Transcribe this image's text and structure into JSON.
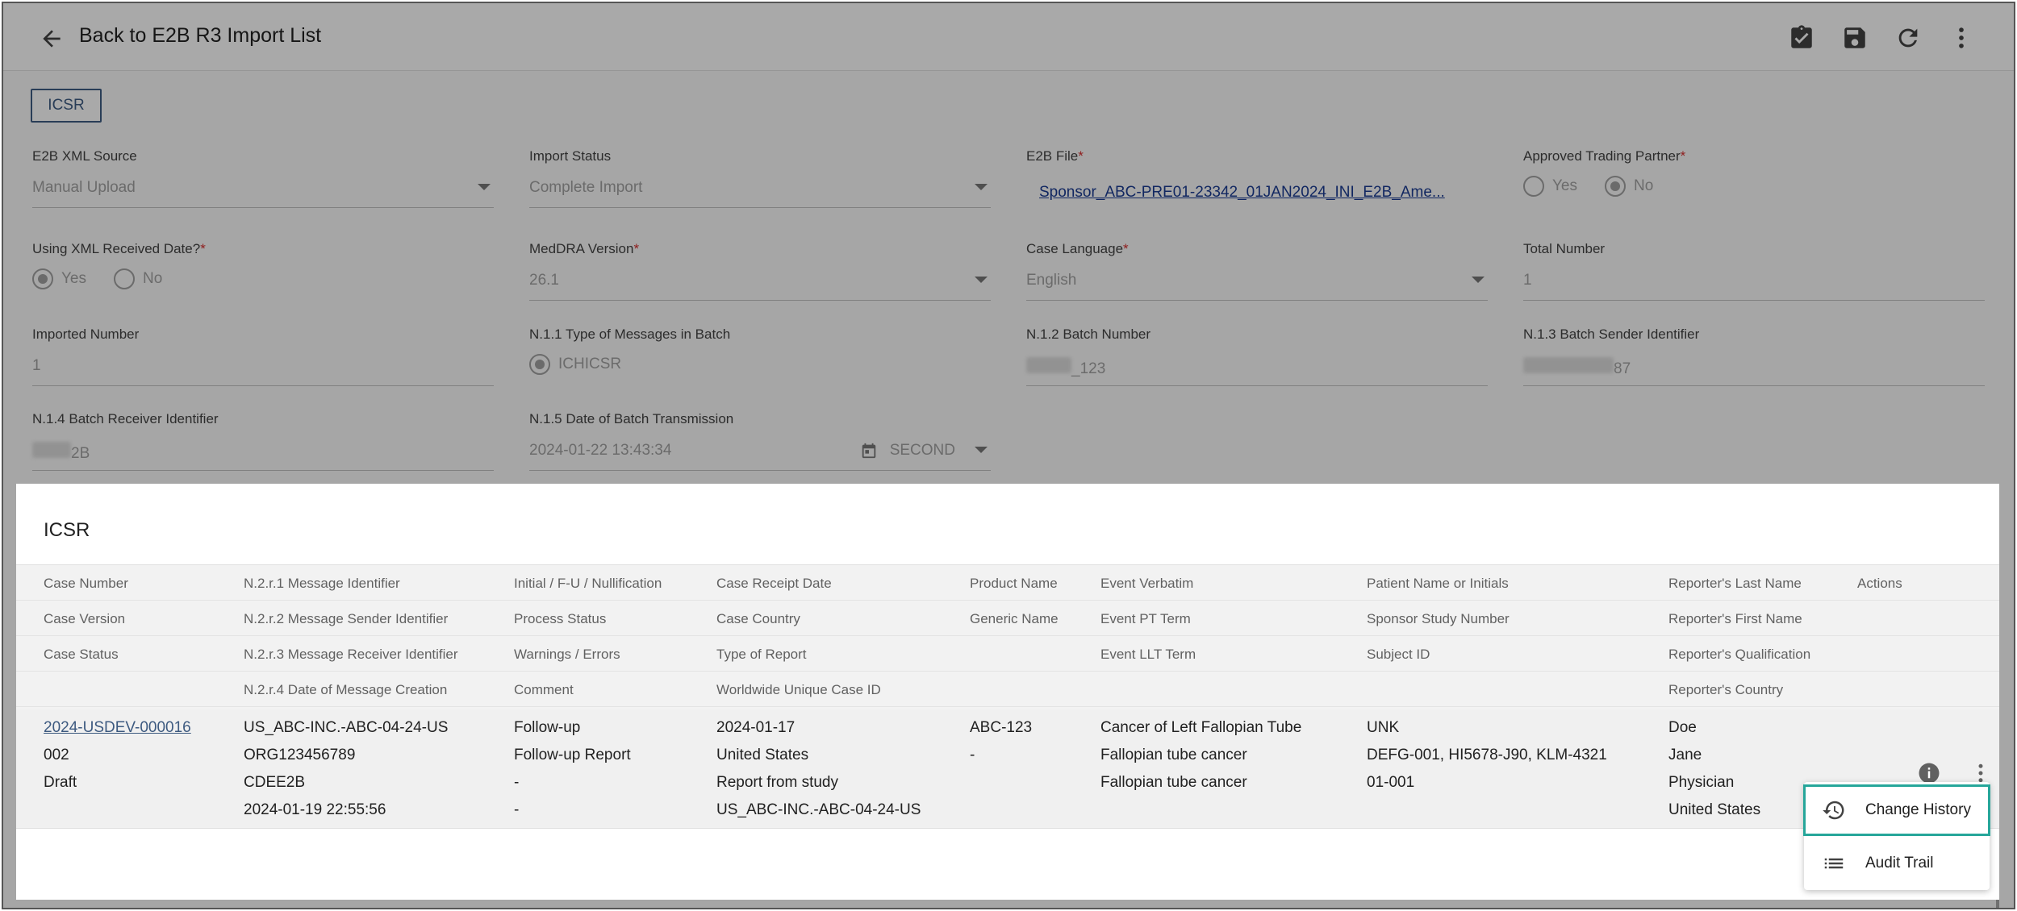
{
  "header": {
    "back_label": "Back to E2B R3 Import List",
    "icons": [
      "back-arrow-icon",
      "approve-clipboard-icon",
      "save-icon",
      "refresh-icon",
      "more-vert-icon"
    ]
  },
  "tab": {
    "label": "ICSR"
  },
  "form": {
    "xml_source": {
      "label": "E2B XML Source",
      "value": "Manual Upload"
    },
    "import_status": {
      "label": "Import Status",
      "value": "Complete Import"
    },
    "e2b_file": {
      "label": "E2B File",
      "value": "Sponsor_ABC-PRE01-23342_01JAN2024_INI_E2B_Ame..."
    },
    "approved_tp": {
      "label": "Approved Trading Partner",
      "yes": "Yes",
      "no": "No",
      "selected": "No"
    },
    "using_xml_date": {
      "label": "Using XML Received Date?",
      "yes": "Yes",
      "no": "No",
      "selected": "Yes"
    },
    "meddra": {
      "label": "MedDRA Version",
      "value": "26.1"
    },
    "case_language": {
      "label": "Case Language",
      "value": "English"
    },
    "total_number": {
      "label": "Total Number",
      "value": "1"
    },
    "imported_number": {
      "label": "Imported Number",
      "value": "1"
    },
    "type_messages": {
      "label": "N.1.1 Type of Messages in Batch",
      "value": "ICHICSR"
    },
    "batch_number": {
      "label": "N.1.2 Batch Number",
      "value": "_123"
    },
    "batch_sender": {
      "label": "N.1.3 Batch Sender Identifier",
      "value": "87"
    },
    "batch_receiver": {
      "label": "N.1.4 Batch Receiver Identifier",
      "value": "2B"
    },
    "batch_date": {
      "label": "N.1.5 Date of Batch Transmission",
      "value": "2024-01-22 13:43:34",
      "precision": "SECOND"
    }
  },
  "panel": {
    "title": "ICSR",
    "header_rows": [
      [
        "Case Number",
        "N.2.r.1 Message Identifier",
        "Initial / F-U / Nullification",
        "Case Receipt Date",
        "Product Name",
        "Event Verbatim",
        "Patient Name or Initials",
        "Reporter's Last Name",
        "Actions"
      ],
      [
        "Case Version",
        "N.2.r.2 Message Sender Identifier",
        "Process Status",
        "Case Country",
        "Generic Name",
        "Event PT Term",
        "Sponsor Study Number",
        "Reporter's First Name",
        ""
      ],
      [
        "Case Status",
        "N.2.r.3 Message Receiver Identifier",
        "Warnings / Errors",
        "Type of Report",
        "",
        "Event LLT Term",
        "Subject ID",
        "Reporter's Qualification",
        ""
      ],
      [
        "",
        "N.2.r.4 Date of Message Creation",
        "Comment",
        "Worldwide Unique Case ID",
        "",
        "",
        "",
        "Reporter's Country",
        ""
      ]
    ],
    "row": {
      "lines": [
        [
          "2024-USDEV-000016",
          "US_ABC-INC.-ABC-04-24-US",
          "Follow-up",
          "2024-01-17",
          "ABC-123",
          "Cancer of Left Fallopian Tube",
          "UNK",
          "Doe"
        ],
        [
          "002",
          "ORG123456789",
          "Follow-up Report",
          "United States",
          "-",
          "Fallopian tube cancer",
          "DEFG-001, HI5678-J90, KLM-4321",
          "Jane"
        ],
        [
          "Draft",
          "CDEE2B",
          "-",
          "Report from study",
          "",
          "Fallopian tube cancer",
          "01-001",
          "Physician"
        ],
        [
          "",
          "2024-01-19 22:55:56",
          "-",
          "US_ABC-INC.-ABC-04-24-US",
          "",
          "",
          "",
          "United States"
        ]
      ]
    }
  },
  "menu": {
    "items": [
      {
        "label": "Change History",
        "icon": "history-icon"
      },
      {
        "label": "Audit Trail",
        "icon": "list-icon"
      }
    ]
  },
  "colors": {
    "accent": "#3d5a80",
    "required": "#d32f2f",
    "menu_highlight": "#26a69a"
  }
}
